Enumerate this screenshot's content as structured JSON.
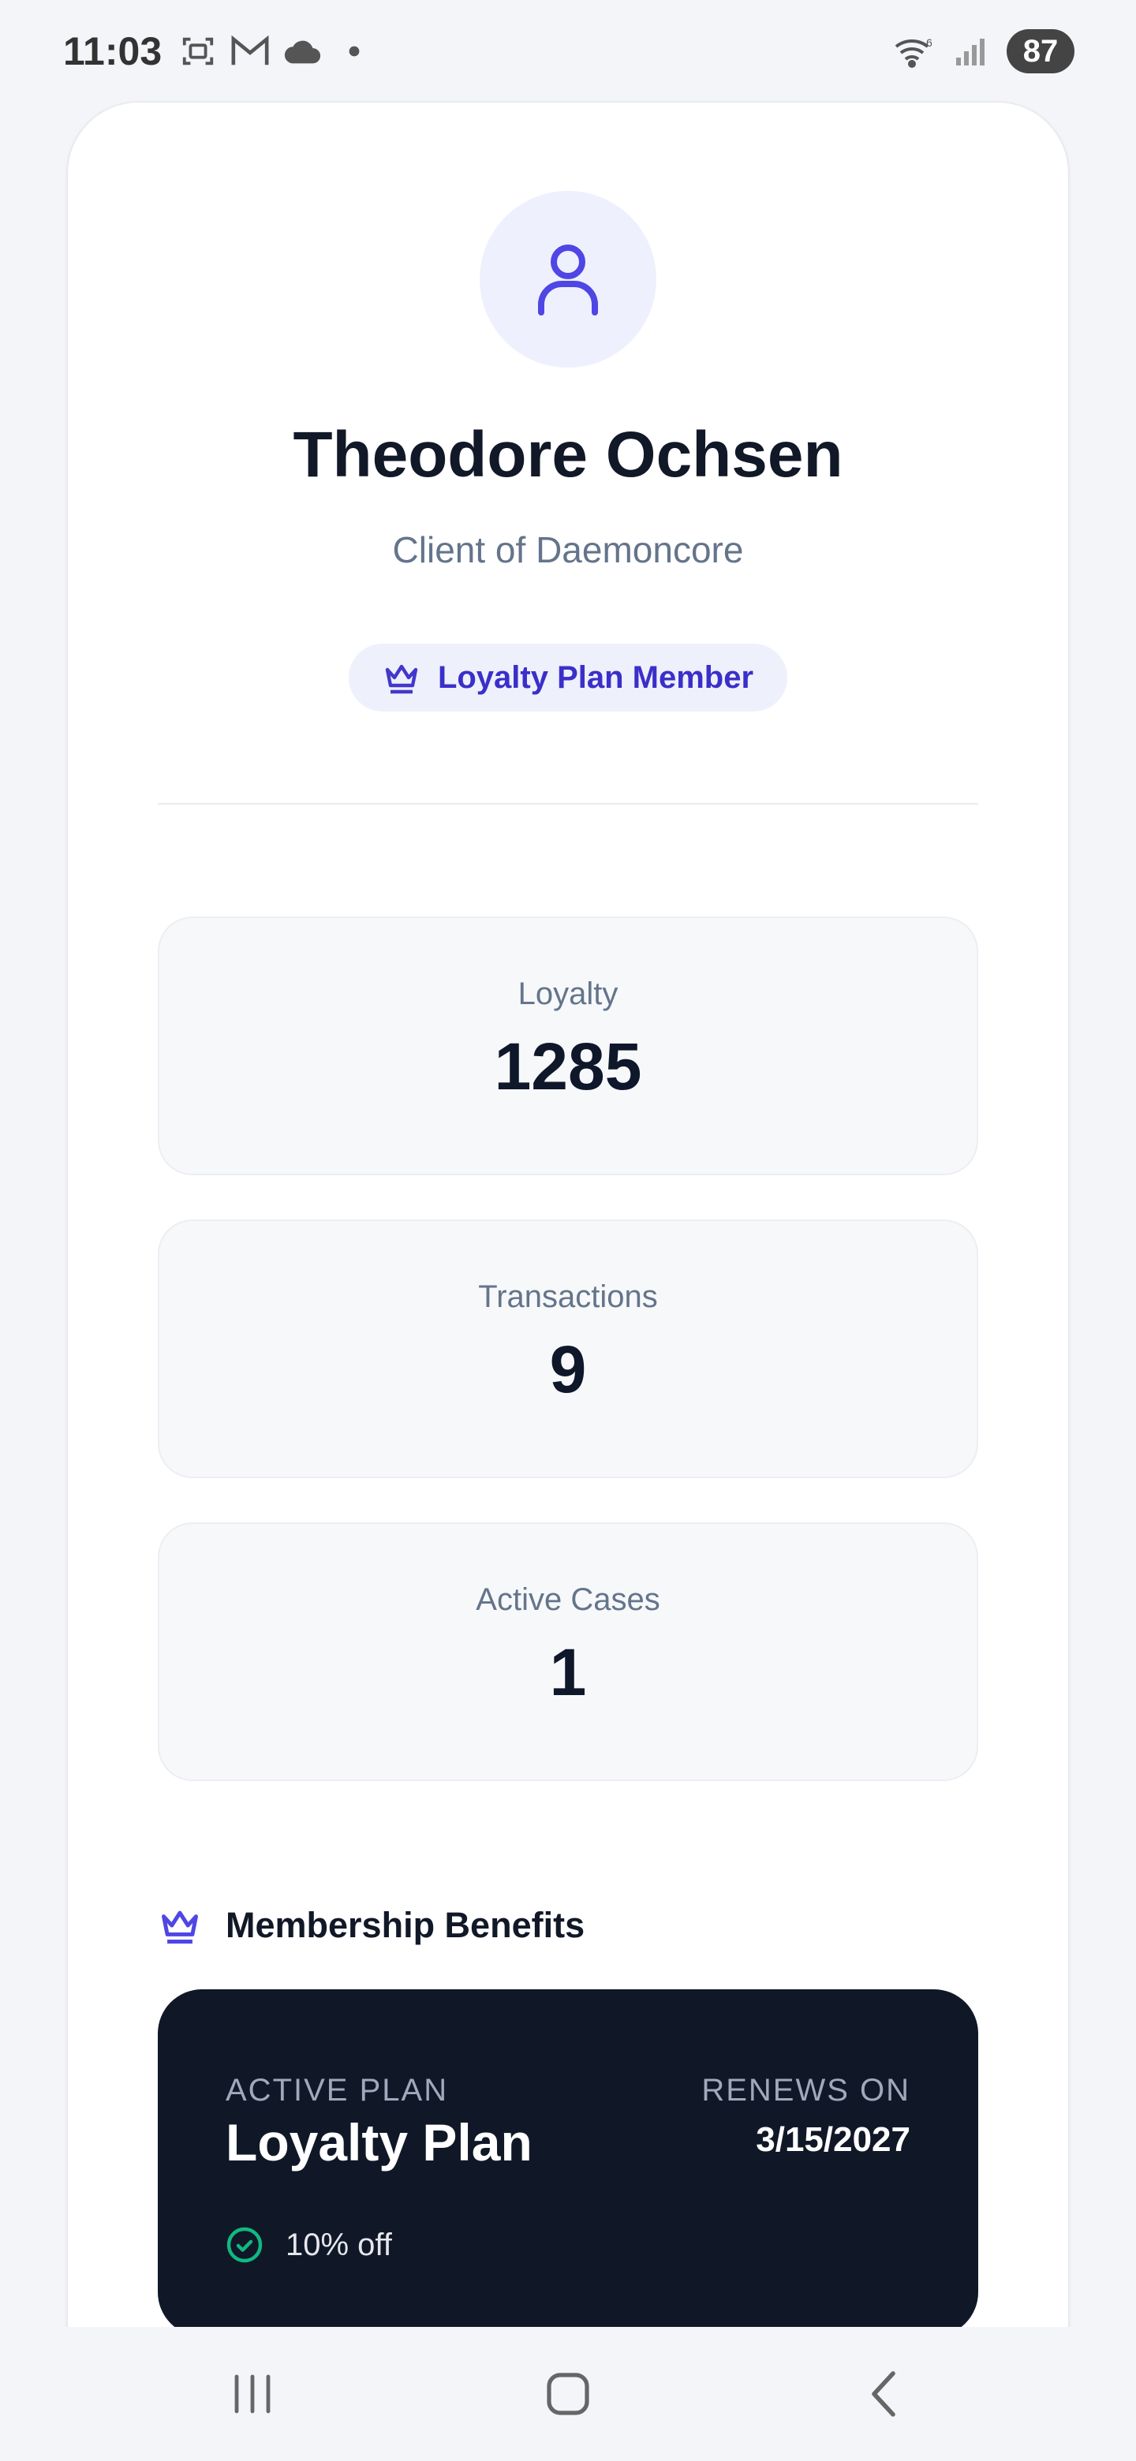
{
  "status_bar": {
    "time": "11:03",
    "battery": "87",
    "icons": [
      "screenshot-icon",
      "gmail-icon",
      "cloud-icon",
      "dot-icon",
      "wifi-icon",
      "signal-icon"
    ]
  },
  "profile": {
    "name": "Theodore Ochsen",
    "subtitle": "Client of Daemoncore",
    "badge": "Loyalty Plan Member"
  },
  "stats": [
    {
      "label": "Loyalty",
      "value": "1285"
    },
    {
      "label": "Transactions",
      "value": "9"
    },
    {
      "label": "Active Cases",
      "value": "1"
    }
  ],
  "membership": {
    "section_title": "Membership Benefits",
    "active_plan_label": "ACTIVE PLAN",
    "plan_name": "Loyalty Plan",
    "renews_label": "RENEWS ON",
    "renews_date": "3/15/2027",
    "benefits": [
      "10% off"
    ]
  },
  "colors": {
    "accent": "#4338ca",
    "accent_bg": "#eef0fc",
    "plan_card_bg": "#101828",
    "check_green": "#10b981"
  },
  "nav": {
    "items": [
      "recents-icon",
      "home-icon",
      "back-icon"
    ]
  }
}
